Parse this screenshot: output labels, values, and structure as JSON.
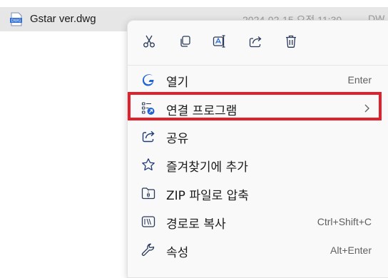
{
  "file": {
    "name": "Gstar ver.dwg",
    "icon_text": "DWG",
    "date": "2024-02-15 오전 11:30",
    "type": "DW"
  },
  "toolbar": {
    "icons": [
      "cut-icon",
      "copy-icon",
      "rename-icon",
      "share-icon",
      "delete-icon"
    ]
  },
  "menu": {
    "items": [
      {
        "label": "열기",
        "shortcut": "Enter",
        "icon": "gstar-app-icon"
      },
      {
        "label": "연결 프로그램",
        "shortcut": "",
        "icon": "open-with-icon",
        "submenu": true
      },
      {
        "label": "공유",
        "shortcut": "",
        "icon": "share-icon"
      },
      {
        "label": "즐겨찾기에 추가",
        "shortcut": "",
        "icon": "star-icon"
      },
      {
        "label": "ZIP 파일로 압축",
        "shortcut": "",
        "icon": "zip-folder-icon"
      },
      {
        "label": "경로로 복사",
        "shortcut": "Ctrl+Shift+C",
        "icon": "copy-path-icon"
      },
      {
        "label": "속성",
        "shortcut": "Alt+Enter",
        "icon": "wrench-icon"
      }
    ]
  },
  "colors": {
    "accent": "#2f6fd6",
    "highlight_border": "#e0202a"
  }
}
